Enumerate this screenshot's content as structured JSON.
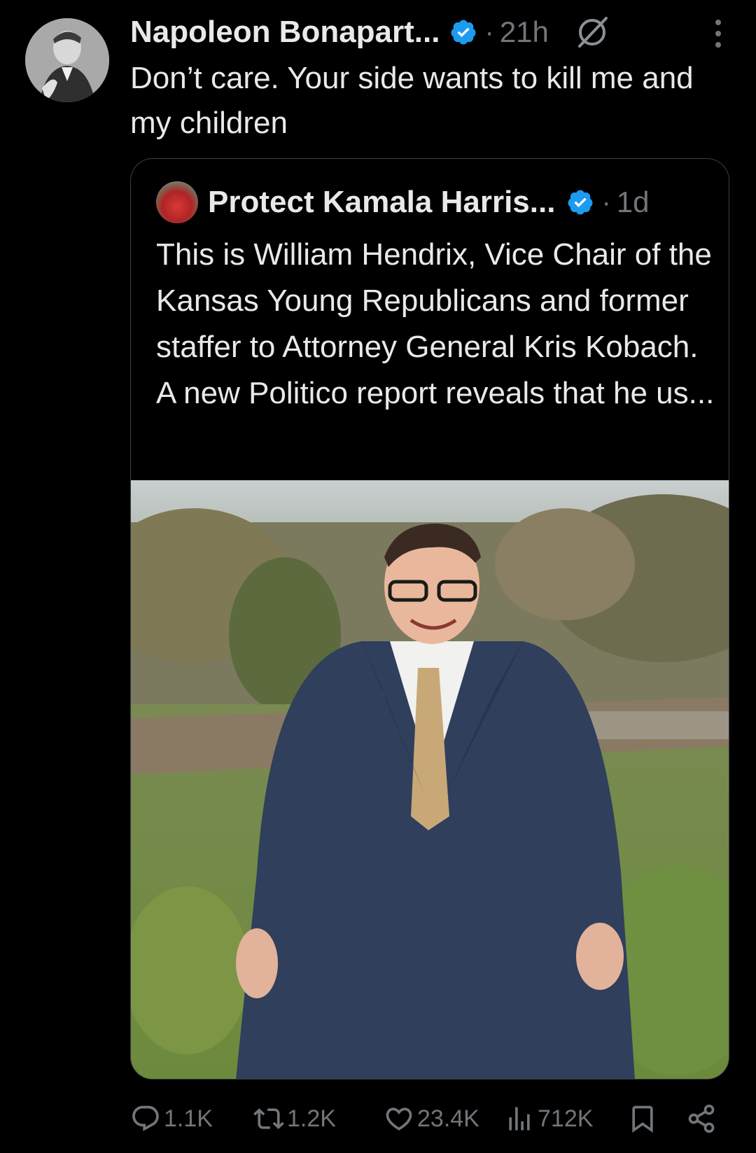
{
  "post": {
    "author_name": "Napoleon Bonapart...",
    "separator": "·",
    "time": "21h",
    "text": "Don’t care. Your side wants to kill me and my children"
  },
  "quote": {
    "author_name": "Protect Kamala Harris...",
    "separator": "·",
    "time": "1d",
    "text": "This is William Hendrix, Vice Chair of the Kansas Young Republicans and former staffer to Attorney General Kris Kobach. A new Politico report reveals that he us..."
  },
  "actions": {
    "replies": "1.1K",
    "reposts": "1.2K",
    "likes": "23.4K",
    "views": "712K"
  },
  "colors": {
    "background": "#000000",
    "text": "#e7e9ea",
    "muted": "#71767b",
    "verified_blue": "#1d9bf0",
    "border": "#3a3f44"
  },
  "icons": [
    "verified-badge-icon",
    "grok-icon",
    "more-icon",
    "reply-icon",
    "repost-icon",
    "like-icon",
    "views-icon",
    "bookmark-icon",
    "share-icon"
  ]
}
